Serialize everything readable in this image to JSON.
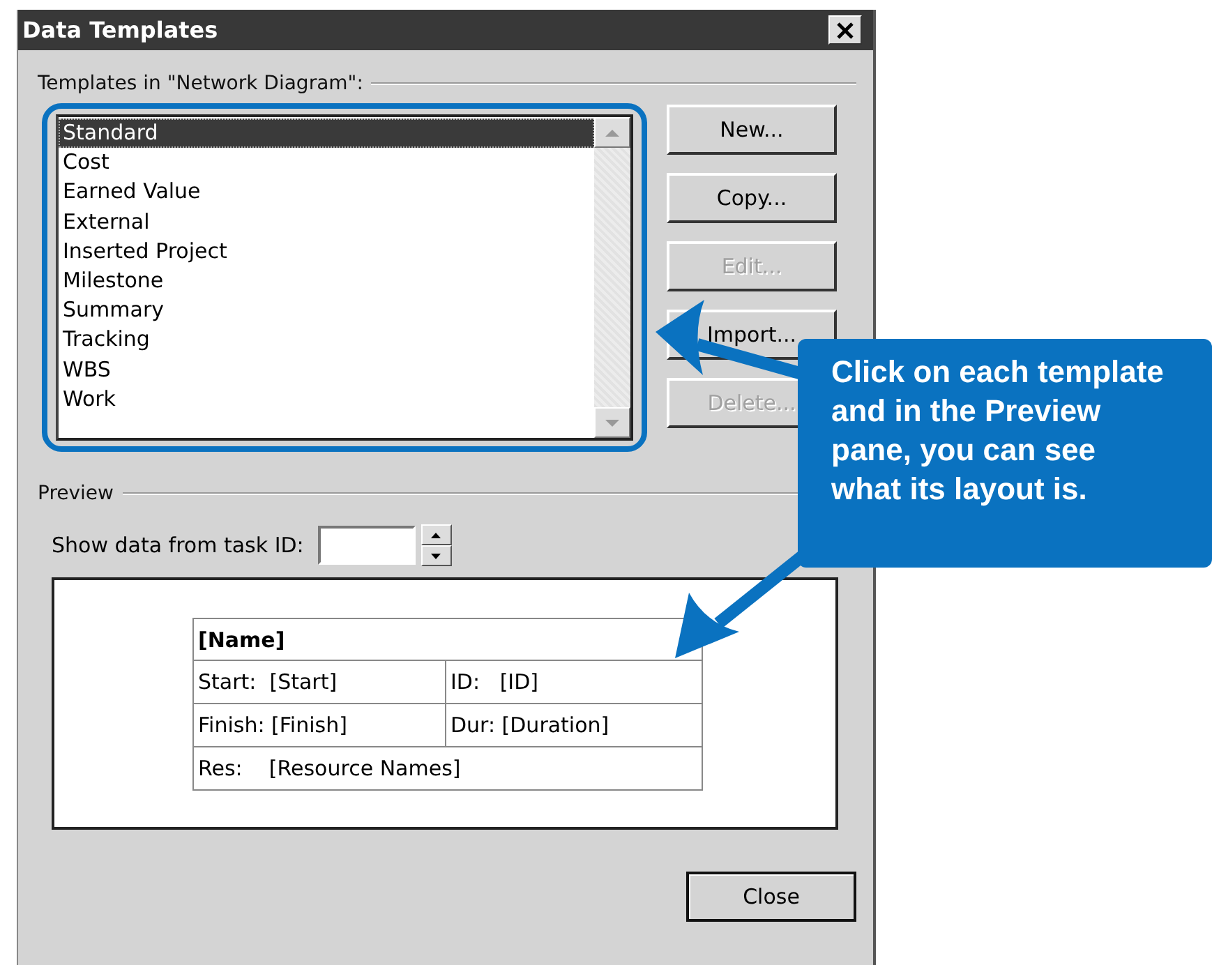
{
  "window": {
    "title": "Data Templates"
  },
  "templates": {
    "label": "Templates in \"Network Diagram\":",
    "items": [
      {
        "label": "Standard",
        "selected": true
      },
      {
        "label": "Cost",
        "selected": false
      },
      {
        "label": "Earned Value",
        "selected": false
      },
      {
        "label": "External",
        "selected": false
      },
      {
        "label": "Inserted Project",
        "selected": false
      },
      {
        "label": "Milestone",
        "selected": false
      },
      {
        "label": "Summary",
        "selected": false
      },
      {
        "label": "Tracking",
        "selected": false
      },
      {
        "label": "WBS",
        "selected": false
      },
      {
        "label": "Work",
        "selected": false
      }
    ]
  },
  "buttons": [
    {
      "label": "New...",
      "disabled": false
    },
    {
      "label": "Copy...",
      "disabled": false
    },
    {
      "label": "Edit...",
      "disabled": true
    },
    {
      "label": "Import...",
      "disabled": false
    },
    {
      "label": "Delete...",
      "disabled": true
    }
  ],
  "preview": {
    "label": "Preview",
    "task_id_label": "Show data from task ID:",
    "layout": {
      "title": "[Name]",
      "rows": [
        [
          "Start:  [Start]",
          "ID:   [ID]"
        ],
        [
          "Finish: [Finish]",
          "Dur: [Duration]"
        ],
        [
          "Res:    [Resource Names]"
        ]
      ]
    }
  },
  "close_button": "Close",
  "callout": {
    "text": "Click on each template and in the Preview pane, you can see what its layout is."
  }
}
